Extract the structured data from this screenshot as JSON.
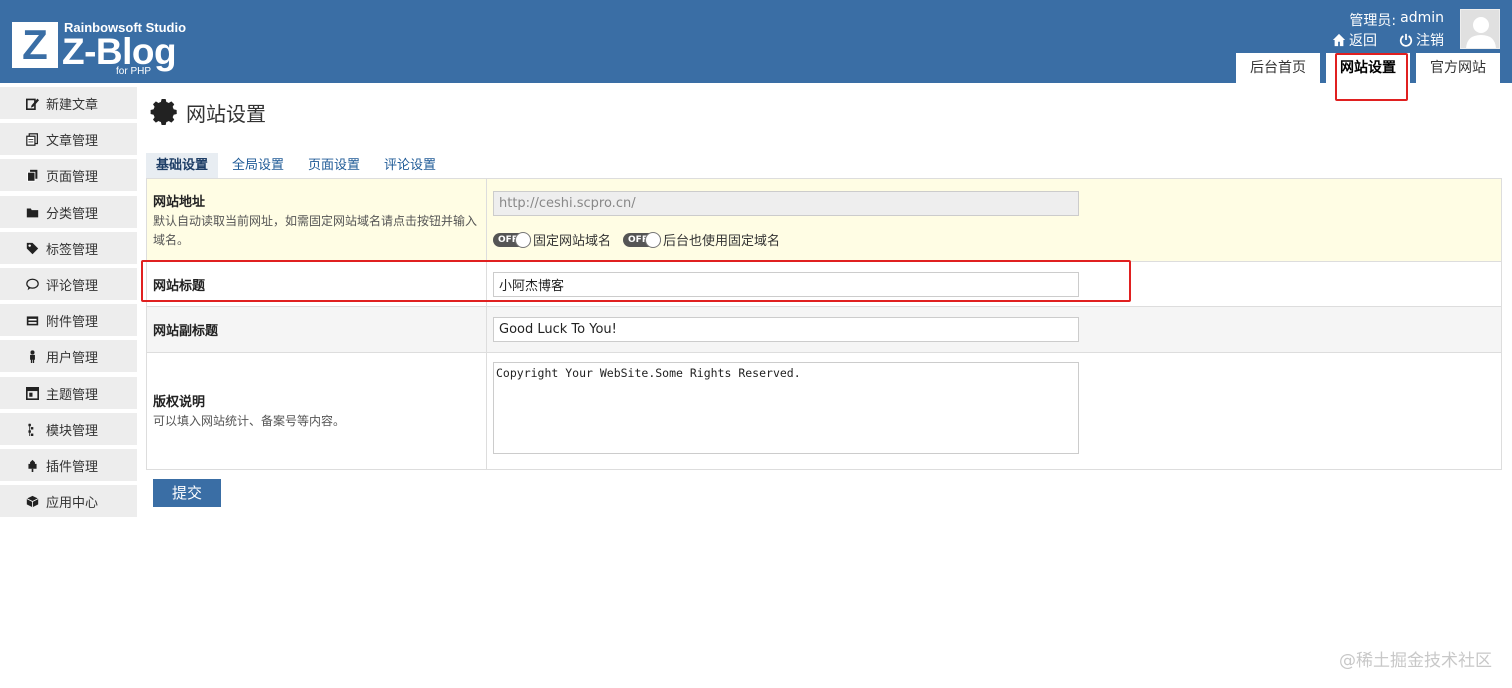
{
  "header": {
    "logo_letter": "Z",
    "logo_studio": "Rainbowsoft Studio",
    "logo_main": "Z-Blog",
    "logo_sub": "for PHP",
    "admin_label": "管理员:",
    "admin_name": "admin",
    "back_label": "返回",
    "logout_label": "注销",
    "tabs": [
      {
        "label": "后台首页"
      },
      {
        "label": "网站设置"
      },
      {
        "label": "官方网站"
      }
    ],
    "bg_color": "#3a6ea5"
  },
  "sidebar": {
    "groups": [
      [
        {
          "label": "新建文章",
          "icon": "edit-icon"
        },
        {
          "label": "文章管理",
          "icon": "document-icon"
        },
        {
          "label": "页面管理",
          "icon": "pages-icon"
        }
      ],
      [
        {
          "label": "分类管理",
          "icon": "folder-icon"
        },
        {
          "label": "标签管理",
          "icon": "tag-icon"
        },
        {
          "label": "评论管理",
          "icon": "comment-icon"
        },
        {
          "label": "附件管理",
          "icon": "attachment-icon"
        },
        {
          "label": "用户管理",
          "icon": "user-icon"
        }
      ],
      [
        {
          "label": "主题管理",
          "icon": "theme-icon"
        },
        {
          "label": "模块管理",
          "icon": "module-icon"
        },
        {
          "label": "插件管理",
          "icon": "plugin-icon"
        },
        {
          "label": "应用中心",
          "icon": "box-icon"
        }
      ]
    ]
  },
  "main": {
    "title": "网站设置",
    "sub_tabs": [
      "基础设置",
      "全局设置",
      "页面设置",
      "评论设置"
    ],
    "rows": {
      "site_url": {
        "label": "网站地址",
        "desc": "默认自动读取当前网址，如需固定网站域名请点击按钮并输入域名。",
        "value": "http://ceshi.scpro.cn/",
        "toggle_text": "OFF",
        "toggle1_label": "固定网站域名",
        "toggle2_label": "后台也使用固定域名"
      },
      "site_title": {
        "label": "网站标题",
        "value": "小阿杰博客"
      },
      "site_subtitle": {
        "label": "网站副标题",
        "value": "Good Luck To You!"
      },
      "copyright": {
        "label": "版权说明",
        "desc": "可以填入网站统计、备案号等内容。",
        "value": "Copyright Your WebSite.Some Rights Reserved."
      }
    },
    "submit_label": "提交"
  },
  "watermark": "@稀土掘金技术社区"
}
